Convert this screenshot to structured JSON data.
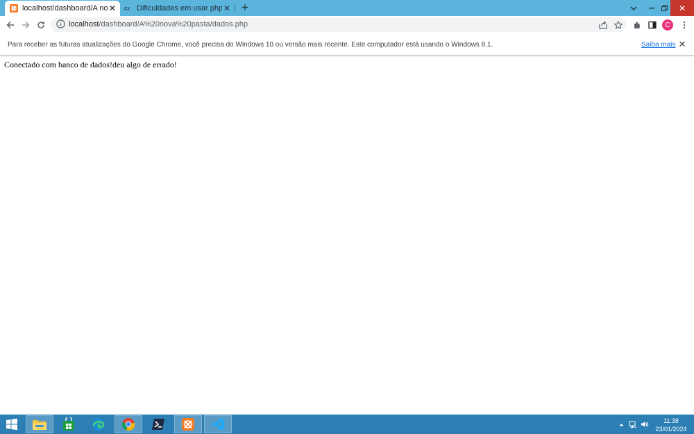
{
  "browser": {
    "tabs": [
      {
        "title": "localhost/dashboard/A nova pasta",
        "favicon": "xampp-icon",
        "active": true
      },
      {
        "title": "Dificuldades em usar phpmyadmin",
        "favicon": "forum-logo-icon",
        "active": false
      }
    ],
    "newtab_label": "+",
    "url": {
      "host": "localhost",
      "path": "/dashboard/A%20nova%20pasta/dados.php"
    },
    "avatar_letter": "C"
  },
  "infobar": {
    "message": "Para receber as futuras atualizações do Google Chrome, você precisa do Windows 10 ou versão mais recente. Este computador está usando o Windows 8.1.",
    "link": "Saiba mais"
  },
  "page": {
    "text": "Conectado com banco de dados!deu algo de errado!"
  },
  "taskbar": {
    "apps": [
      "windows-start-icon",
      "file-explorer-icon",
      "store-icon",
      "edge-icon",
      "chrome-icon",
      "powershell-icon",
      "xampp-icon",
      "vscode-icon"
    ],
    "clock": {
      "time": "11:38",
      "date": "23/01/2024"
    }
  },
  "colors": {
    "tabstrip": "#5ab4dc",
    "taskbar": "#2b7fb4",
    "link": "#1a73e8",
    "avatar": "#e8347c"
  }
}
